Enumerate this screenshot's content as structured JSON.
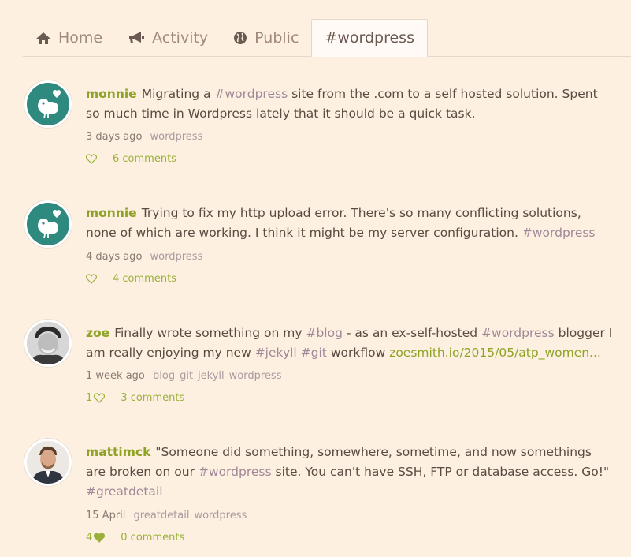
{
  "tabs": [
    {
      "label": "Home",
      "icon": "home-icon"
    },
    {
      "label": "Activity",
      "icon": "megaphone-icon"
    },
    {
      "label": "Public",
      "icon": "globe-icon"
    },
    {
      "label": "#wordpress",
      "icon": ""
    }
  ],
  "active_tab": 3,
  "colors": {
    "background": "#fdf0e0",
    "username": "#8ea326",
    "hashtag": "#a08898",
    "link": "#8ea326",
    "like": "#9bb03a"
  },
  "posts": [
    {
      "user": "monnie",
      "avatar": "bird-avatar",
      "text": [
        {
          "t": "Migrating a "
        },
        {
          "t": "#wordpress",
          "k": "tag"
        },
        {
          "t": " site from the .com to a self hosted solution. Spent so much time in Wordpress lately that it should be a quick task."
        }
      ],
      "time": "3 days ago",
      "tags": [
        "wordpress"
      ],
      "likes": "",
      "liked": false,
      "comments": "6 comments"
    },
    {
      "user": "monnie",
      "avatar": "bird-avatar",
      "text": [
        {
          "t": "Trying to fix my http upload error. There's so many conflicting solutions, none of which are working. I think it might be my server configuration. "
        },
        {
          "t": "#wordpress",
          "k": "tag"
        }
      ],
      "time": "4 days ago",
      "tags": [
        "wordpress"
      ],
      "likes": "",
      "liked": false,
      "comments": "4 comments"
    },
    {
      "user": "zoe",
      "avatar": "photo-avatar-zoe",
      "text": [
        {
          "t": "Finally wrote something on my "
        },
        {
          "t": "#blog",
          "k": "tag"
        },
        {
          "t": " - as an ex-self-hosted "
        },
        {
          "t": "#wordpress",
          "k": "tag"
        },
        {
          "t": " blogger I am really enjoying my new "
        },
        {
          "t": "#jekyll",
          "k": "tag"
        },
        {
          "t": " "
        },
        {
          "t": "#git",
          "k": "tag"
        },
        {
          "t": " workflow "
        },
        {
          "t": "zoesmith.io/2015/05/atp_women...",
          "k": "link"
        }
      ],
      "time": "1 week ago",
      "tags": [
        "blog",
        "git",
        "jekyll",
        "wordpress"
      ],
      "likes": "1",
      "liked": false,
      "comments": "3 comments"
    },
    {
      "user": "mattimck",
      "avatar": "photo-avatar-mattimck",
      "text": [
        {
          "t": "\"Someone did something, somewhere, sometime, and now somethings are broken on our "
        },
        {
          "t": "#wordpress",
          "k": "tag"
        },
        {
          "t": " site. You can't have SSH, FTP or database access. Go!\" "
        },
        {
          "t": "#greatdetail",
          "k": "tag"
        }
      ],
      "time": "15 April",
      "tags": [
        "greatdetail",
        "wordpress"
      ],
      "likes": "4",
      "liked": true,
      "comments": "0 comments"
    }
  ]
}
